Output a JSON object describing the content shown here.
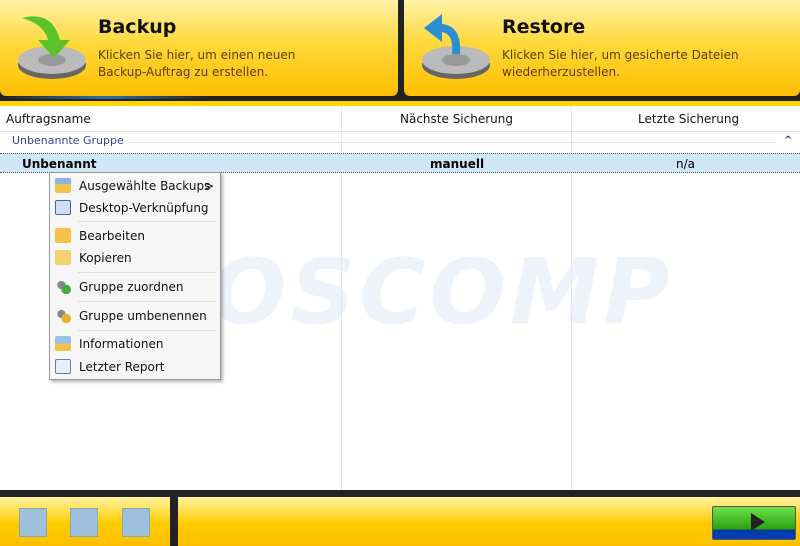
{
  "panels": {
    "backup": {
      "title": "Backup",
      "desc_line1": "Klicken Sie hier, um einen neuen",
      "desc_line2": "Backup-Auftrag zu erstellen."
    },
    "restore": {
      "title": "Restore",
      "desc_line1": "Klicken Sie hier, um gesicherte Dateien",
      "desc_line2": "wiederherzustellen."
    }
  },
  "table": {
    "columns": [
      "Auftragsname",
      "Nächste Sicherung",
      "Letzte Sicherung"
    ],
    "group": "Unbenannte Gruppe",
    "rows": [
      {
        "name": "Unbenannt",
        "next": "manuell",
        "last": "n/a"
      }
    ]
  },
  "watermark": "OSCOMP",
  "context_menu": {
    "items": [
      {
        "label": "Ausgewählte Backups",
        "icon": "backups-folder-icon",
        "submenu": ">"
      },
      {
        "label": "Desktop-Verknüpfung",
        "icon": "desktop-shortcut-icon"
      },
      {
        "label": "Bearbeiten",
        "icon": "edit-folder-icon"
      },
      {
        "label": "Kopieren",
        "icon": "copy-folder-icon"
      },
      {
        "label": "Gruppe zuordnen",
        "icon": "group-assign-icon"
      },
      {
        "label": "Gruppe umbenennen",
        "icon": "group-rename-icon"
      },
      {
        "label": "Informationen",
        "icon": "info-icon"
      },
      {
        "label": "Letzter Report",
        "icon": "report-icon"
      }
    ]
  },
  "colors": {
    "accent": "#ffcc00",
    "selection": "#cfe6f7",
    "group_text": "#33449a"
  }
}
